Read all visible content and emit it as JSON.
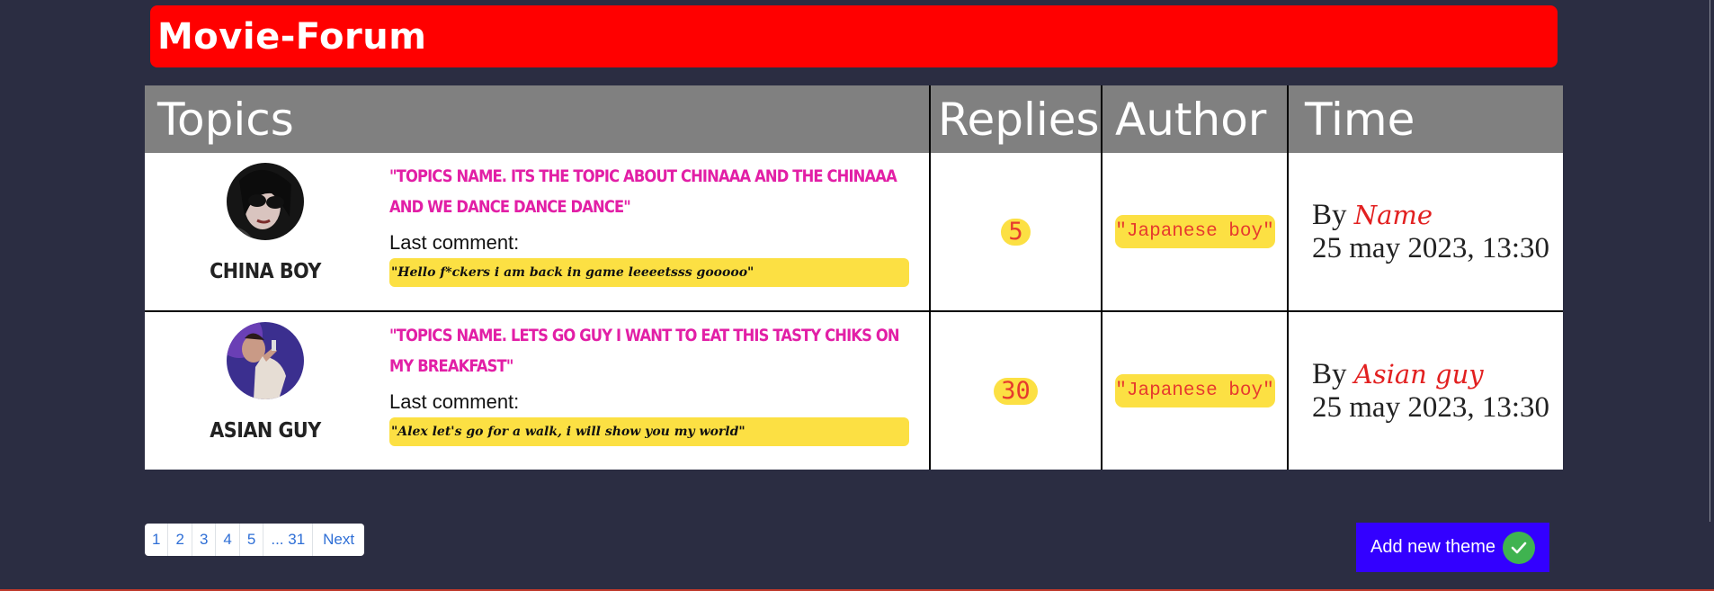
{
  "header": {
    "title": "Movie-Forum"
  },
  "table": {
    "columns": [
      "Topics",
      "Replies",
      "Author",
      "Time"
    ],
    "rows": [
      {
        "user": "China boy",
        "avatar_icon": "avatar-woman-sunglasses",
        "title": "\"Topics name. Its the topic about chinaaa and the chinaaa and we dance dance dance\"",
        "last_comment_label": "Last comment:",
        "last_comment": "\"Hello f*ckers i am back in game leeeetsss gooooo\"",
        "replies": "5",
        "author": "\"Japanese boy\"",
        "by_label": "By",
        "by_name": "Name",
        "date": "25 may 2023, 13:30"
      },
      {
        "user": "Asian guy",
        "avatar_icon": "avatar-man-drinking",
        "title": "\"Topics name. Lets go guy i want to eat this tasty chiks on my breakfast\"",
        "last_comment_label": "Last comment:",
        "last_comment": "\"Alex let's go for a walk, i will show you my world\"",
        "replies": "30",
        "author": "\"Japanese boy\"",
        "by_label": "By",
        "by_name": "Asian guy",
        "date": "25 may 2023, 13:30"
      }
    ]
  },
  "pagination": [
    "1",
    "2",
    "3",
    "4",
    "5",
    "... 31",
    "Next"
  ],
  "add_button": {
    "label": "Add new theme",
    "icon": "check-icon"
  },
  "colors": {
    "background": "#2b2d42",
    "header": "#ff0000",
    "topic_title": "#e21fa6",
    "badge": "#fce043",
    "badge_text": "#e63a2e",
    "button": "#3300ff",
    "check": "#3fb350"
  }
}
